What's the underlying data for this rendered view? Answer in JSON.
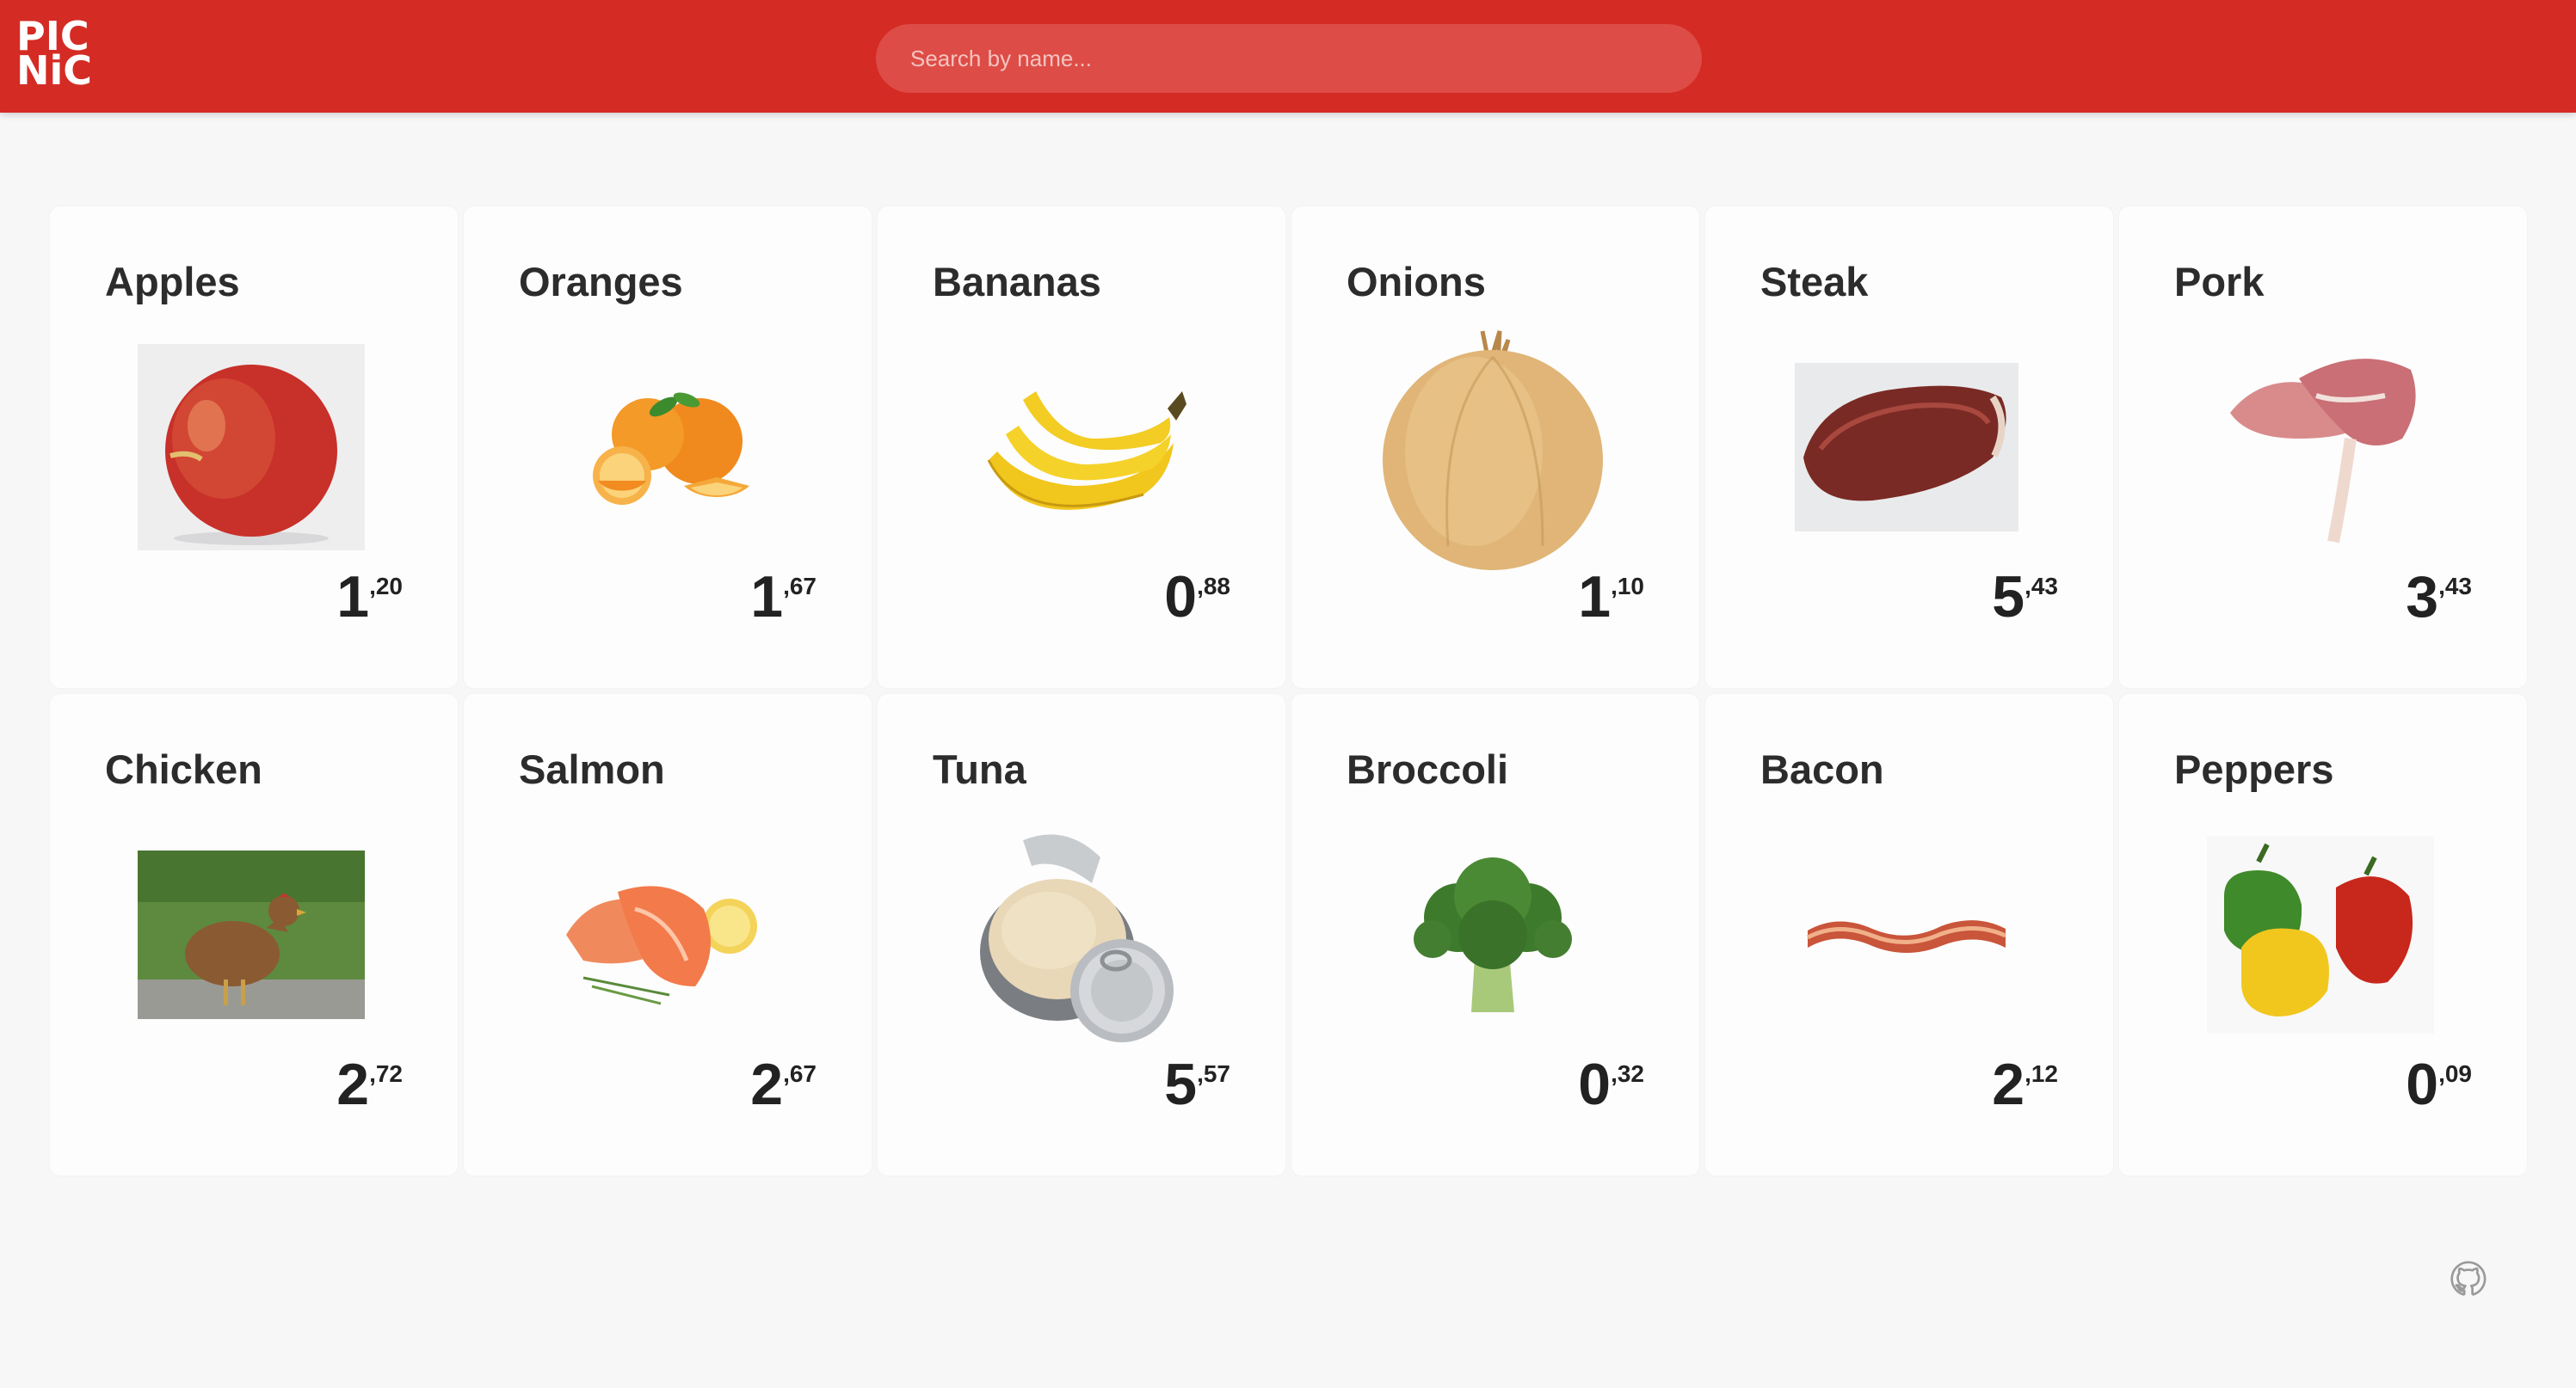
{
  "header": {
    "logo_line1": "PIC",
    "logo_line2": "NiC",
    "search_placeholder": "Search by name...",
    "accent_color": "#d52b25"
  },
  "products": [
    {
      "name": "Apples",
      "price_int": "1",
      "price_cents": ",20",
      "icon": "apple-image"
    },
    {
      "name": "Oranges",
      "price_int": "1",
      "price_cents": ",67",
      "icon": "oranges-image"
    },
    {
      "name": "Bananas",
      "price_int": "0",
      "price_cents": ",88",
      "icon": "bananas-image"
    },
    {
      "name": "Onions",
      "price_int": "1",
      "price_cents": ",10",
      "icon": "onion-image"
    },
    {
      "name": "Steak",
      "price_int": "5",
      "price_cents": ",43",
      "icon": "steak-image"
    },
    {
      "name": "Pork",
      "price_int": "3",
      "price_cents": ",43",
      "icon": "pork-image"
    },
    {
      "name": "Chicken",
      "price_int": "2",
      "price_cents": ",72",
      "icon": "chicken-image"
    },
    {
      "name": "Salmon",
      "price_int": "2",
      "price_cents": ",67",
      "icon": "salmon-image"
    },
    {
      "name": "Tuna",
      "price_int": "5",
      "price_cents": ",57",
      "icon": "tuna-can-image"
    },
    {
      "name": "Broccoli",
      "price_int": "0",
      "price_cents": ",32",
      "icon": "broccoli-image"
    },
    {
      "name": "Bacon",
      "price_int": "2",
      "price_cents": ",12",
      "icon": "bacon-image"
    },
    {
      "name": "Peppers",
      "price_int": "0",
      "price_cents": ",09",
      "icon": "peppers-image"
    }
  ],
  "footer": {
    "icon": "github-icon"
  }
}
